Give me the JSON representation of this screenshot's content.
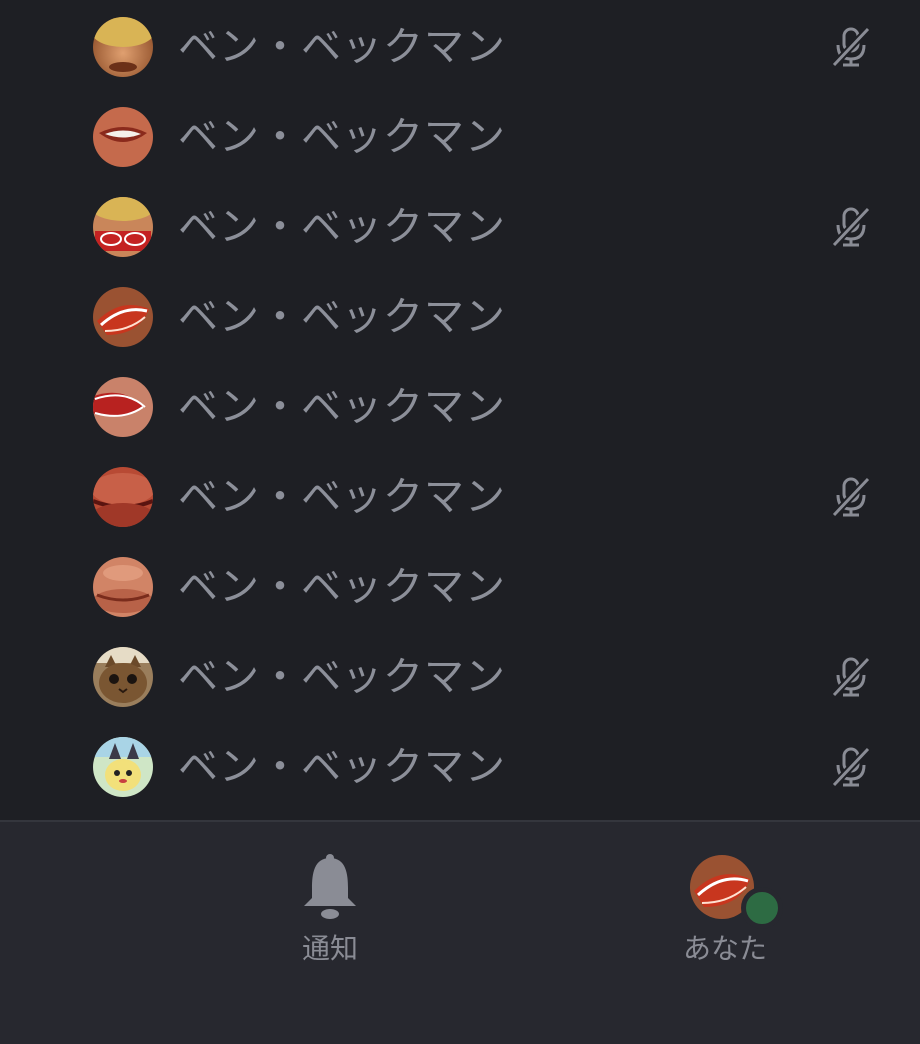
{
  "member_list": {
    "members": [
      {
        "name": "ベン・ベックマン",
        "avatar_icon": "face-avatar-icon",
        "muted": true
      },
      {
        "name": "ベン・ベックマン",
        "avatar_icon": "smile-avatar-icon",
        "muted": false
      },
      {
        "name": "ベン・ベックマン",
        "avatar_icon": "face-avatar-icon",
        "muted": true
      },
      {
        "name": "ベン・ベックマン",
        "avatar_icon": "lips-avatar-icon",
        "muted": false
      },
      {
        "name": "ベン・ベックマン",
        "avatar_icon": "lips-avatar-icon",
        "muted": false
      },
      {
        "name": "ベン・ベックマン",
        "avatar_icon": "lips-avatar-icon",
        "muted": true
      },
      {
        "name": "ベン・ベックマン",
        "avatar_icon": "lips-avatar-icon",
        "muted": false
      },
      {
        "name": "ベン・ベックマン",
        "avatar_icon": "cat-avatar-icon",
        "muted": true
      },
      {
        "name": "ベン・ベックマン",
        "avatar_icon": "cartoon-avatar-icon",
        "muted": true
      }
    ]
  },
  "tab_bar": {
    "notifications_label": "通知",
    "notifications_icon": "bell-icon",
    "you_label": "あなた",
    "you_avatar_icon": "lips-avatar-icon",
    "status": "online"
  },
  "colors": {
    "background": "#1e1f24",
    "tab_bar_background": "#27282f",
    "text": "#8c8f99",
    "muted_icon": "#8a8c95",
    "online_status": "#2d6b43"
  }
}
